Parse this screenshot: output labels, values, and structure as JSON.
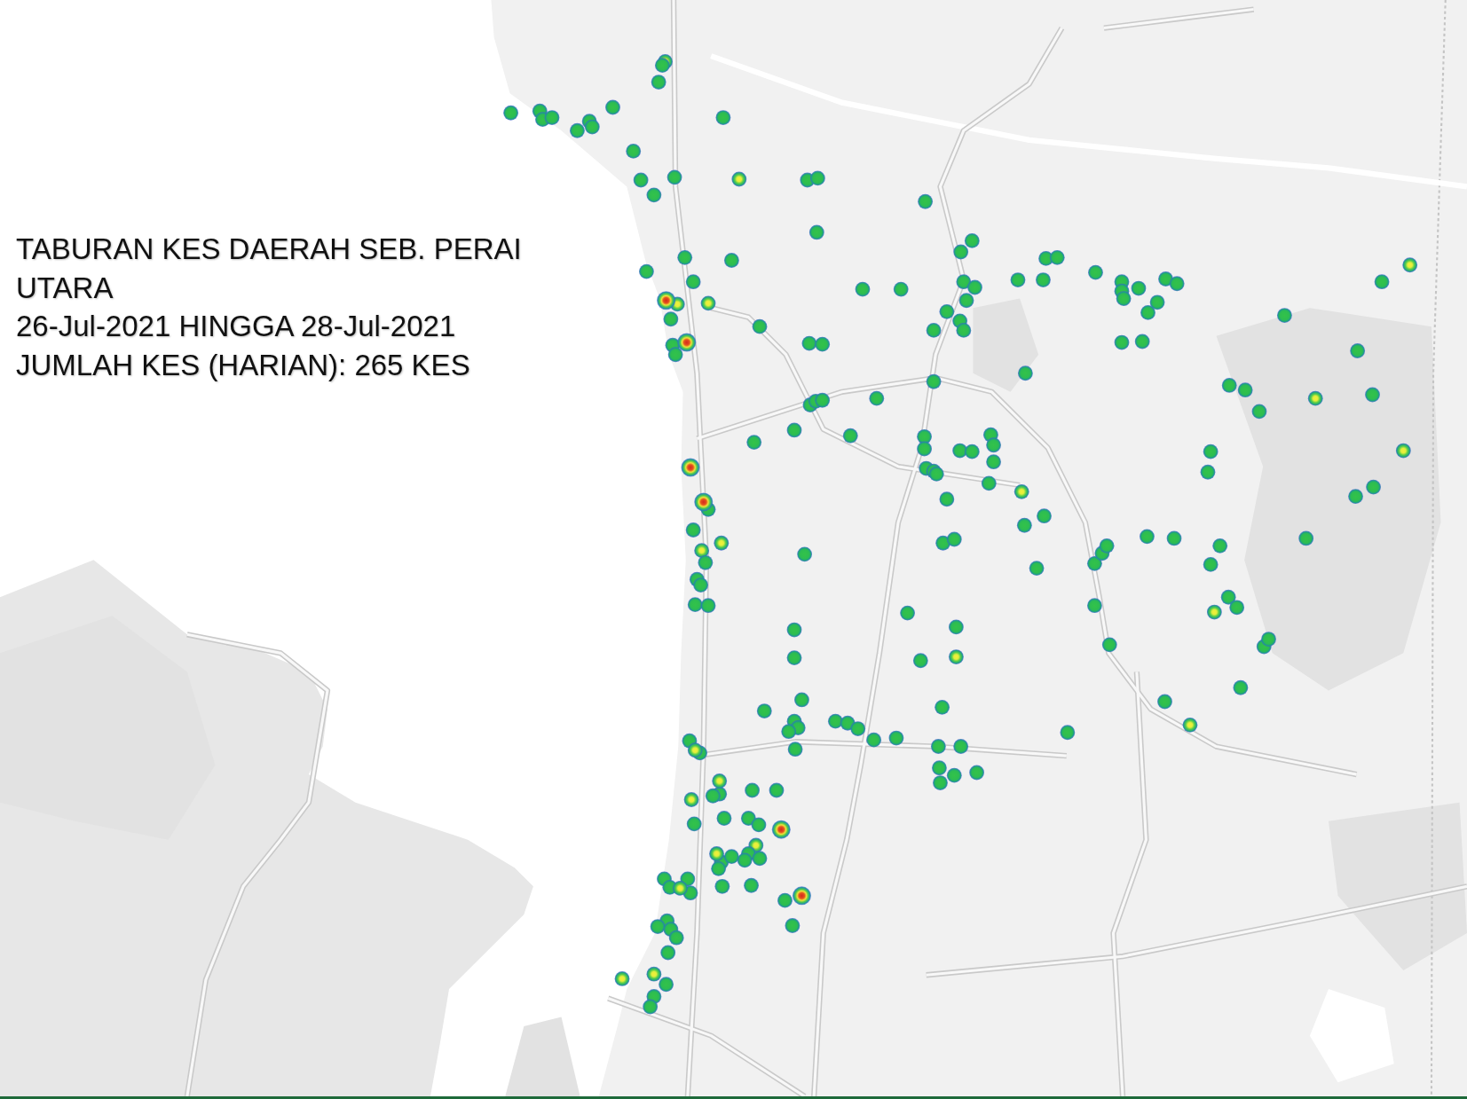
{
  "map": {
    "title": "TABURAN KES DAERAH SEB. PERAI UTARA",
    "date_range": "26-Jul-2021 HINGGA 28-Jul-2021",
    "total_cases": "JUMLAH KES (HARIAN): 265 KES"
  }
}
